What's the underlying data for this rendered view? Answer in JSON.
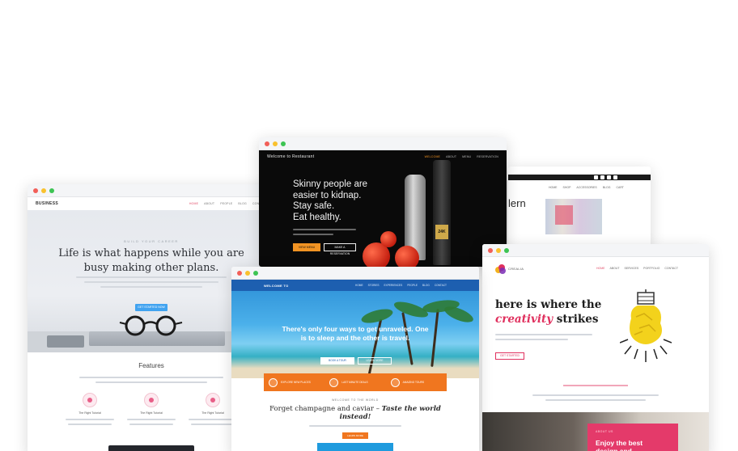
{
  "window_business": {
    "brand": "BUSINESS",
    "menu": [
      "HOME",
      "ABOUT",
      "PEOPLE",
      "BLOG",
      "CONTACT"
    ],
    "overline": "BUILD YOUR CAREER",
    "headline_line1": "Life is what happens while you are",
    "headline_line2": "busy making other plans.",
    "cta": "GET STARTED NOW",
    "features_title": "Features",
    "feature_titles": [
      "The Right Tutorial",
      "The Right Tutorial",
      "The Right Tutorial"
    ]
  },
  "window_restaurant": {
    "brand": "Welcome to Restaurant",
    "menu": [
      "WELCOME",
      "ABOUT",
      "MENU",
      "RESERVATION"
    ],
    "headline": [
      "Skinny people are",
      "easier to kidnap.",
      "Stay safe.",
      "Eat healthy."
    ],
    "btn_primary": "VIEW MENU",
    "btn_secondary": "MAKE A RESERVATION",
    "bottle_label": "24K"
  },
  "window_modern": {
    "menu": [
      "HOME",
      "SHOP",
      "ACCESSORIES",
      "BLOG",
      "CART"
    ],
    "hero_text": "lern"
  },
  "window_creative": {
    "brand": "CREALIA",
    "menu": [
      "HOME",
      "ABOUT",
      "SERVICES",
      "PORTFOLIO",
      "CONTACT"
    ],
    "headline_line1": "here is where the",
    "headline_accent": "creativity",
    "headline_strong": " strikes",
    "cta": "GET STARTED",
    "pink_small": "ABOUT US",
    "pink_title": "Enjoy the best design and"
  },
  "window_travel": {
    "brand": "WELCOME TO",
    "menu": [
      "HOME",
      "STORIES",
      "EXPERIENCES",
      "PEOPLE",
      "BLOG",
      "CONTACT"
    ],
    "headline": "There's only four ways to get unraveled. One is to sleep and the other is travel.",
    "btn_primary": "BOOK A TOUR",
    "btn_secondary": "LEARN MORE",
    "features": [
      "EXPLORE NEW PLACES",
      "LAST MINUTE DEALS",
      "AMAZING TOURS"
    ],
    "welcome": "WELCOME TO THE WORLD",
    "line_plain": "Forget champagne and caviar – ",
    "line_italic": "Taste the world",
    "line_italic2": "instead!",
    "btn_small": "LEARN MORE"
  },
  "colors": {
    "pink_accent": "#e0305e",
    "orange_accent": "#f0761f",
    "blue_accent": "#1d5fb0",
    "restaurant_orange": "#f19323"
  }
}
